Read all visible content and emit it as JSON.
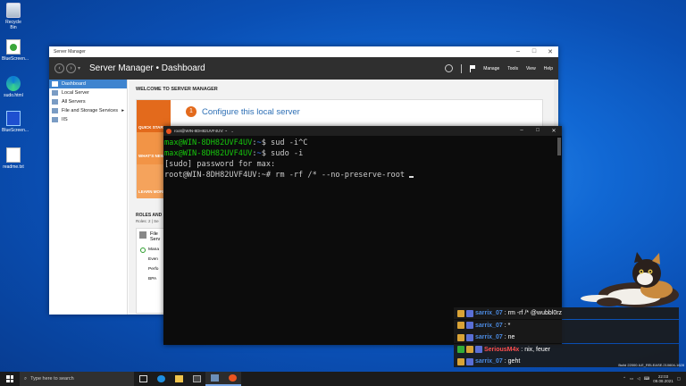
{
  "desktop_icons": [
    {
      "label": "Recycle Bin"
    },
    {
      "label": "BlueScreen..."
    },
    {
      "label": "sudo.html"
    },
    {
      "label": "BlueScreen..."
    },
    {
      "label": "readme.txt"
    }
  ],
  "server_manager": {
    "window_title": "Server Manager",
    "breadcrumb_app": "Server Manager",
    "breadcrumb_sep": "•",
    "breadcrumb_page": "Dashboard",
    "menu": [
      "Manage",
      "Tools",
      "View",
      "Help"
    ],
    "sidebar": [
      {
        "label": "Dashboard",
        "active": true
      },
      {
        "label": "Local Server"
      },
      {
        "label": "All Servers"
      },
      {
        "label": "File and Storage Services",
        "chevron": "▸"
      },
      {
        "label": "IIS"
      }
    ],
    "welcome_heading": "WELCOME TO SERVER MANAGER",
    "quick_start_label": "QUICK START",
    "whats_new_label": "WHAT'S NEW",
    "learn_more_label": "LEARN MORE",
    "configure_step_number": "1",
    "configure_text": "Configure this local server",
    "roles_heading": "ROLES AND",
    "roles_sub": "Roles: 2  |  Se",
    "tile": {
      "title": "File",
      "title2": "Serv",
      "rows": [
        "Mana",
        "Even",
        "Perfo",
        "BPA"
      ]
    }
  },
  "terminal": {
    "window_title": "root@WIN-8DH82UVF4UV: ~",
    "lines": [
      {
        "user": "max@WIN-8DH82UVF4UV",
        "path": "~",
        "symbol": "$",
        "command": " sud -i^C"
      },
      {
        "user": "max@WIN-8DH82UVF4UV",
        "path": "~",
        "symbol": "$",
        "command": " sudo -i"
      },
      {
        "plain": "[sudo] password for max:"
      },
      {
        "plain": "root@WIN-8DH82UVF4UV:~# rm -rf /* --no-preserve-root"
      }
    ]
  },
  "chat": [
    {
      "user": "sarrix_07",
      "user_color": "#4b8ae0",
      "text": "rm -rf /* @wubbl0rz",
      "badges": [
        "sub",
        "tw"
      ]
    },
    {
      "user": "sarrix_07",
      "user_color": "#4b8ae0",
      "text": "*",
      "badges": [
        "sub",
        "tw"
      ]
    },
    {
      "user": "sarrix_07",
      "user_color": "#4b8ae0",
      "text": "ne",
      "badges": [
        "sub",
        "tw"
      ]
    },
    {
      "user": "SeriousM4x",
      "user_color": "#ff4f4f",
      "text": "nix, feuer",
      "badges": [
        "mod",
        "sub",
        "tw"
      ]
    },
    {
      "user": "sarrix_07",
      "user_color": "#4b8ae0",
      "text": "geht",
      "badges": [
        "sub",
        "tw"
      ]
    }
  ],
  "taskbar": {
    "search_placeholder": "Type here to search",
    "time": "22:03",
    "date": "09.08.2021"
  },
  "watermark": "Build 22000.ILE_RELEASE.210604-1628"
}
